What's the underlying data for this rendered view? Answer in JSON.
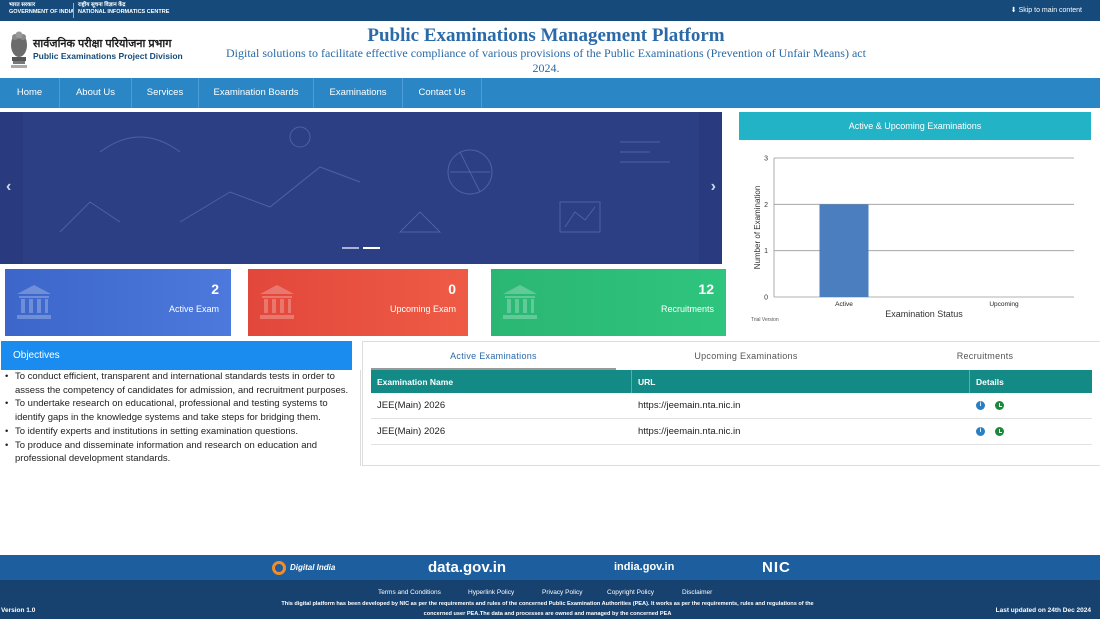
{
  "gov_strip": {
    "gov_hi": "भारत सरकार",
    "gov_en": "GOVERNMENT OF INDIA",
    "nic_hi": "राष्ट्रीय सूचना विज्ञान केंद्र",
    "nic_en": "NATIONAL INFORMATICS CENTRE",
    "skip": "⬇ Skip to main content"
  },
  "header": {
    "division_hi": "सार्वजनिक परीक्षा परियोजना प्रभाग",
    "division_en": "Public Examinations Project Division",
    "title": "Public Examinations Management Platform",
    "subtitle": "Digital solutions to facilitate effective compliance of various provisions of the Public Examinations (Prevention of Unfair Means) act 2024."
  },
  "nav": {
    "items": [
      "Home",
      "About Us",
      "Services",
      "Examination Boards",
      "Examinations",
      "Contact Us"
    ]
  },
  "carousel": {
    "prev": "‹",
    "next": "›"
  },
  "stats": {
    "active": {
      "value": "2",
      "label": "Active Exam"
    },
    "upcoming": {
      "value": "0",
      "label": "Upcoming Exam"
    },
    "recruitments": {
      "value": "12",
      "label": "Recruitments"
    }
  },
  "chart_panel": {
    "heading": "Active & Upcoming Examinations",
    "trial": "Trial Version"
  },
  "chart_data": {
    "type": "bar",
    "categories": [
      "Active",
      "Upcoming"
    ],
    "values": [
      2,
      0
    ],
    "title": "",
    "xlabel": "Examination Status",
    "ylabel": "Number of Examination",
    "ylim": [
      0,
      3
    ],
    "yticks": [
      0,
      1,
      2,
      3
    ],
    "grid": true,
    "bar_color": "#4a7ebf"
  },
  "objectives": {
    "heading": "Objectives",
    "items": [
      "To conduct efficient, transparent and international standards tests in order to assess the competency of candidates for admission, and recruitment purposes.",
      "To undertake research on educational, professional and testing systems to identify gaps in the knowledge systems and take steps for bridging them.",
      "To identify experts and institutions in setting examination questions.",
      "To produce and disseminate information and research on education and professional development standards."
    ]
  },
  "exams": {
    "tabs": [
      "Active Examinations",
      "Upcoming Examinations",
      "Recruitments"
    ],
    "columns": [
      "Examination Name",
      "URL",
      "Details"
    ],
    "rows": [
      {
        "name": "JEE(Main) 2026",
        "url": "https://jeemain.nta.nic.in"
      },
      {
        "name": "JEE(Main) 2026",
        "url": "https://jeemain.nta.nic.in"
      }
    ]
  },
  "partners": {
    "digital_india": "Digital India",
    "data_gov": "data.gov.in",
    "india_gov": "india.gov.in",
    "nic": "NIC"
  },
  "footer": {
    "links": [
      "Terms and Conditions",
      "Hyperlink Policy",
      "Privacy Policy",
      "Copyright Policy",
      "Disclaimer"
    ],
    "description": "This digital platform has been developed by NIC as per the requirements and rules of the concerned Public Examination Authorities (PEA). It works as per the requirements, rules and regulations of the concerned user PEA.The data and processes are owned and managed by the concerned PEA",
    "version": "Version 1.0",
    "updated": "Last updated on 24th Dec 2024"
  }
}
